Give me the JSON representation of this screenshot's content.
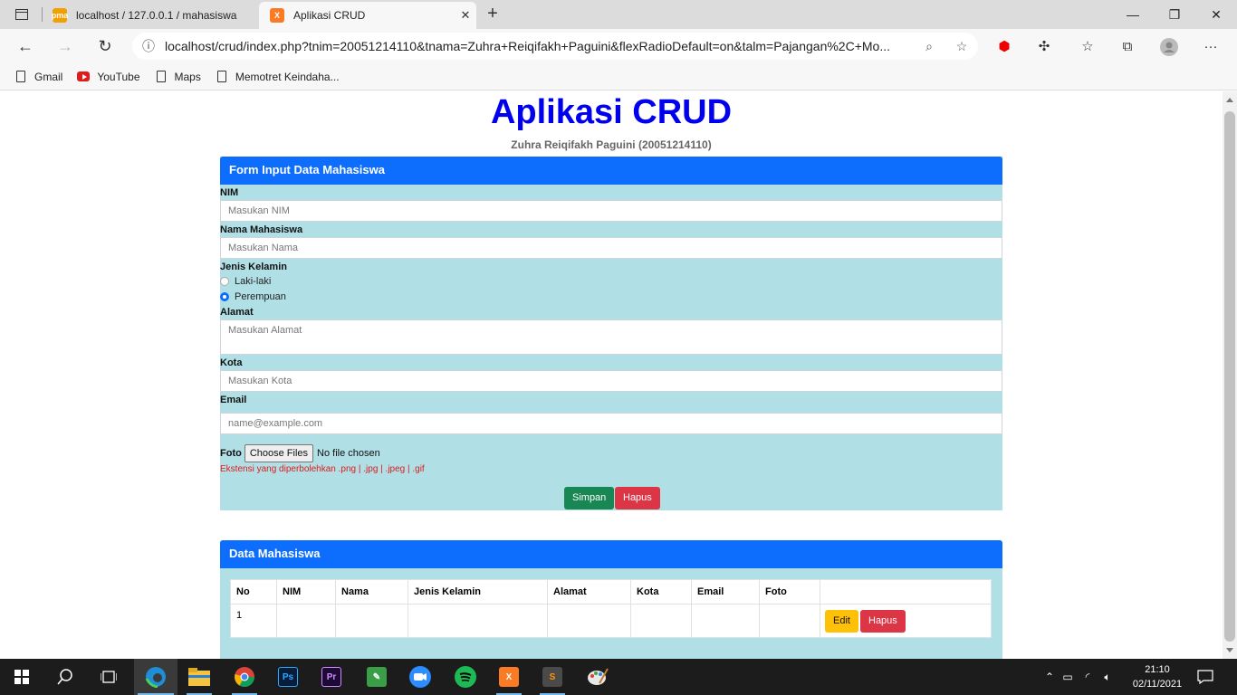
{
  "browser": {
    "tabs": [
      {
        "title": "localhost / 127.0.0.1 / mahasiswa",
        "favicon": "phpmyadmin-icon"
      },
      {
        "title": "Aplikasi CRUD",
        "favicon": "xampp-icon"
      }
    ],
    "url": "localhost/crud/index.php?tnim=20051214110&tnama=Zuhra+Reiqifakh+Paguini&flexRadioDefault=on&talm=Pajangan%2C+Mo...",
    "bookmarks": [
      "Gmail",
      "YouTube",
      "Maps",
      "Memotret Keindaha..."
    ]
  },
  "page": {
    "title": "Aplikasi CRUD",
    "subtitle": "Zuhra Reiqifakh Paguini (20051214110)"
  },
  "form": {
    "header": "Form Input Data Mahasiswa",
    "nim_label": "NIM",
    "nim_placeholder": "Masukan NIM",
    "nama_label": "Nama Mahasiswa",
    "nama_placeholder": "Masukan Nama",
    "jk_label": "Jenis Kelamin",
    "jk_options": [
      "Laki-laki",
      "Perempuan"
    ],
    "jk_selected": "Perempuan",
    "alamat_label": "Alamat",
    "alamat_placeholder": "Masukan Alamat",
    "kota_label": "Kota",
    "kota_placeholder": "Masukan Kota",
    "email_label": "Email",
    "email_placeholder": "name@example.com",
    "foto_label": "Foto",
    "file_button": "Choose Files",
    "file_status": "No file chosen",
    "hint": "Ekstensi yang diperbolehkan .png | .jpg | .jpeg | .gif",
    "simpan": "Simpan",
    "hapus": "Hapus"
  },
  "data_table": {
    "header": "Data Mahasiswa",
    "columns": [
      "No",
      "NIM",
      "Nama",
      "Jenis Kelamin",
      "Alamat",
      "Kota",
      "Email",
      "Foto",
      ""
    ],
    "rows": [
      {
        "no": "1",
        "nim": "",
        "nama": "",
        "jk": "",
        "alamat": "",
        "kota": "",
        "email": "",
        "foto": "",
        "edit": "Edit",
        "hapus": "Hapus"
      }
    ]
  },
  "taskbar": {
    "time": "21:10",
    "date": "02/11/2021"
  },
  "colors": {
    "primary": "#0d6efd",
    "card_bg": "#b0dfe5",
    "title": "#0000ee",
    "success": "#198754",
    "danger": "#dc3545",
    "warning": "#ffc107"
  }
}
